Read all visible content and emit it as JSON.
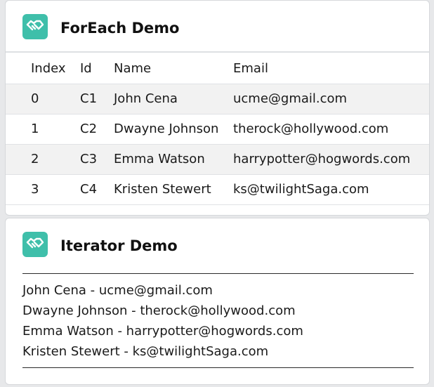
{
  "foreach_card": {
    "title": "ForEach Demo",
    "icon": "handshake-icon",
    "columns": [
      "Index",
      "Id",
      "Name",
      "Email"
    ],
    "rows": [
      {
        "index": "0",
        "id": "C1",
        "name": "John Cena",
        "email": "ucme@gmail.com"
      },
      {
        "index": "1",
        "id": "C2",
        "name": "Dwayne Johnson",
        "email": "therock@hollywood.com"
      },
      {
        "index": "2",
        "id": "C3",
        "name": "Emma Watson",
        "email": "harrypotter@hogwords.com"
      },
      {
        "index": "3",
        "id": "C4",
        "name": "Kristen Stewert",
        "email": "ks@twilightSaga.com"
      }
    ]
  },
  "iterator_card": {
    "title": "Iterator Demo",
    "icon": "handshake-icon",
    "lines": [
      "John Cena - ucme@gmail.com",
      "Dwayne Johnson - therock@hollywood.com",
      "Emma Watson - harrypotter@hogwords.com",
      "Kristen Stewert - ks@twilightSaga.com"
    ]
  },
  "colors": {
    "icon_bg": "#3fbfaa",
    "alt_row": "#f2f2f2",
    "page_bg": "#e7e8ea"
  }
}
